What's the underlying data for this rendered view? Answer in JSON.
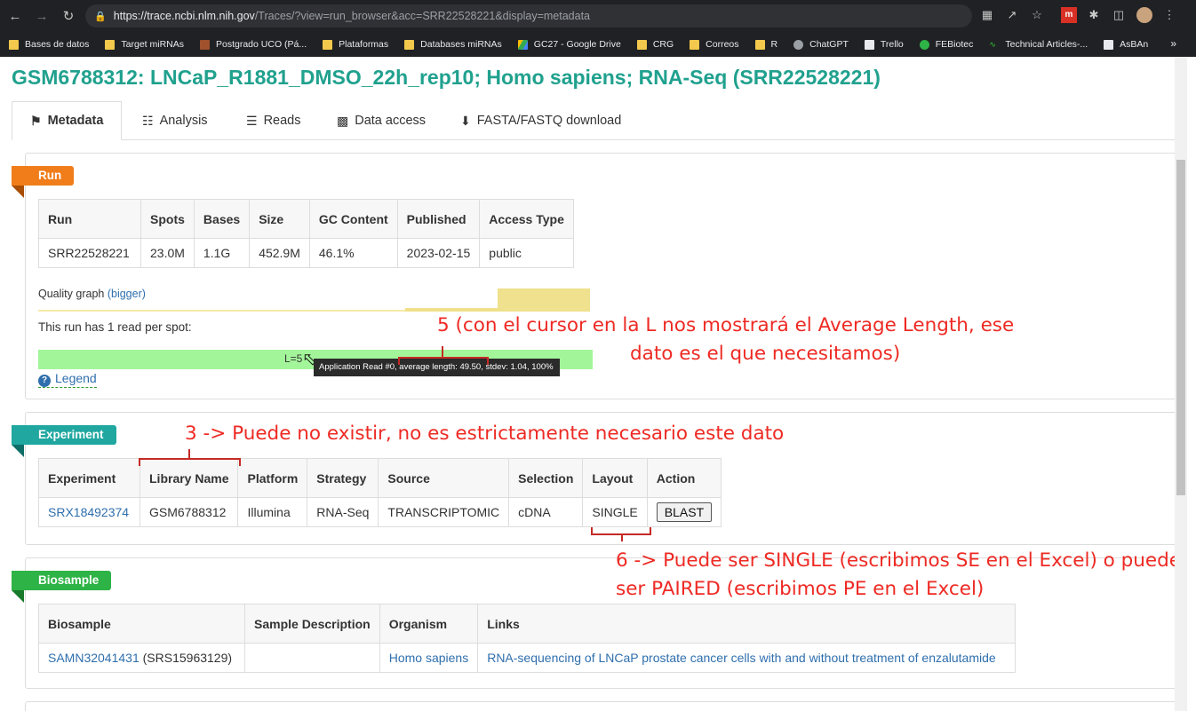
{
  "browser": {
    "url_host": "https://trace.ncbi.nlm.nih.gov",
    "url_path": "/Traces/?view=run_browser&acc=SRR22528221&display=metadata",
    "bookmarks": [
      "Bases de datos",
      "Target miRNAs",
      "Postgrado UCO (Pá...",
      "Plataformas",
      "Databases miRNAs",
      "GC27 - Google Drive",
      "CRG",
      "Correos",
      "R",
      "ChatGPT",
      "Trello",
      "FEBiotec",
      "Technical Articles-...",
      "AsBAn"
    ],
    "bookmarks_more": "»"
  },
  "page": {
    "title": "GSM6788312: LNCaP_R1881_DMSO_22h_rep10; Homo sapiens; RNA-Seq (SRR22528221)",
    "tabs": [
      "Metadata",
      "Analysis",
      "Reads",
      "Data access",
      "FASTA/FASTQ download"
    ]
  },
  "run": {
    "ribbon": "Run",
    "headers": [
      "Run",
      "Spots",
      "Bases",
      "Size",
      "GC Content",
      "Published",
      "Access Type"
    ],
    "row": [
      "SRR22528221",
      "23.0M",
      "1.1G",
      "452.9M",
      "46.1%",
      "2023-02-15",
      "public"
    ],
    "quality_label": "Quality graph",
    "quality_link": "(bigger)",
    "read_per_spot": "This run has 1 read per spot:",
    "bar_label": "L=5",
    "tooltip": "Application Read #0, average length: 49.50, stdev: 1.04, 100%",
    "legend": "Legend"
  },
  "experiment": {
    "ribbon": "Experiment",
    "headers": [
      "Experiment",
      "Library Name",
      "Platform",
      "Strategy",
      "Source",
      "Selection",
      "Layout",
      "Action"
    ],
    "row": [
      "SRX18492374",
      "GSM6788312",
      "Illumina",
      "RNA-Seq",
      "TRANSCRIPTOMIC",
      "cDNA",
      "SINGLE"
    ],
    "action_button": "BLAST"
  },
  "biosample": {
    "ribbon": "Biosample",
    "headers": [
      "Biosample",
      "Sample Description",
      "Organism",
      "Links"
    ],
    "biosample_id": "SAMN32041431",
    "biosample_srs": "(SRS15963129)",
    "description": "",
    "organism": "Homo sapiens",
    "links": "RNA-sequencing of LNCaP prostate cancer cells with and without treatment of enzalutamide"
  },
  "annotations": {
    "a5_line1": "5 (con el cursor en la L nos mostrará el Average Length, ese",
    "a5_line2": "dato es el que necesitamos)",
    "a3": "3 -> Puede no existir, no es estrictamente necesario este dato",
    "a6_line1": "6 -> Puede ser SINGLE (escribimos SE en el Excel) o puede",
    "a6_line2": "ser PAIRED (escribimos PE en el Excel)"
  },
  "colors": {
    "title": "#20a18e",
    "run_ribbon": "#f07d1a",
    "experiment_ribbon": "#1fa7a0",
    "biosample_ribbon": "#2eb346",
    "annotation": "#ee2a24",
    "link": "#2f6fad"
  }
}
